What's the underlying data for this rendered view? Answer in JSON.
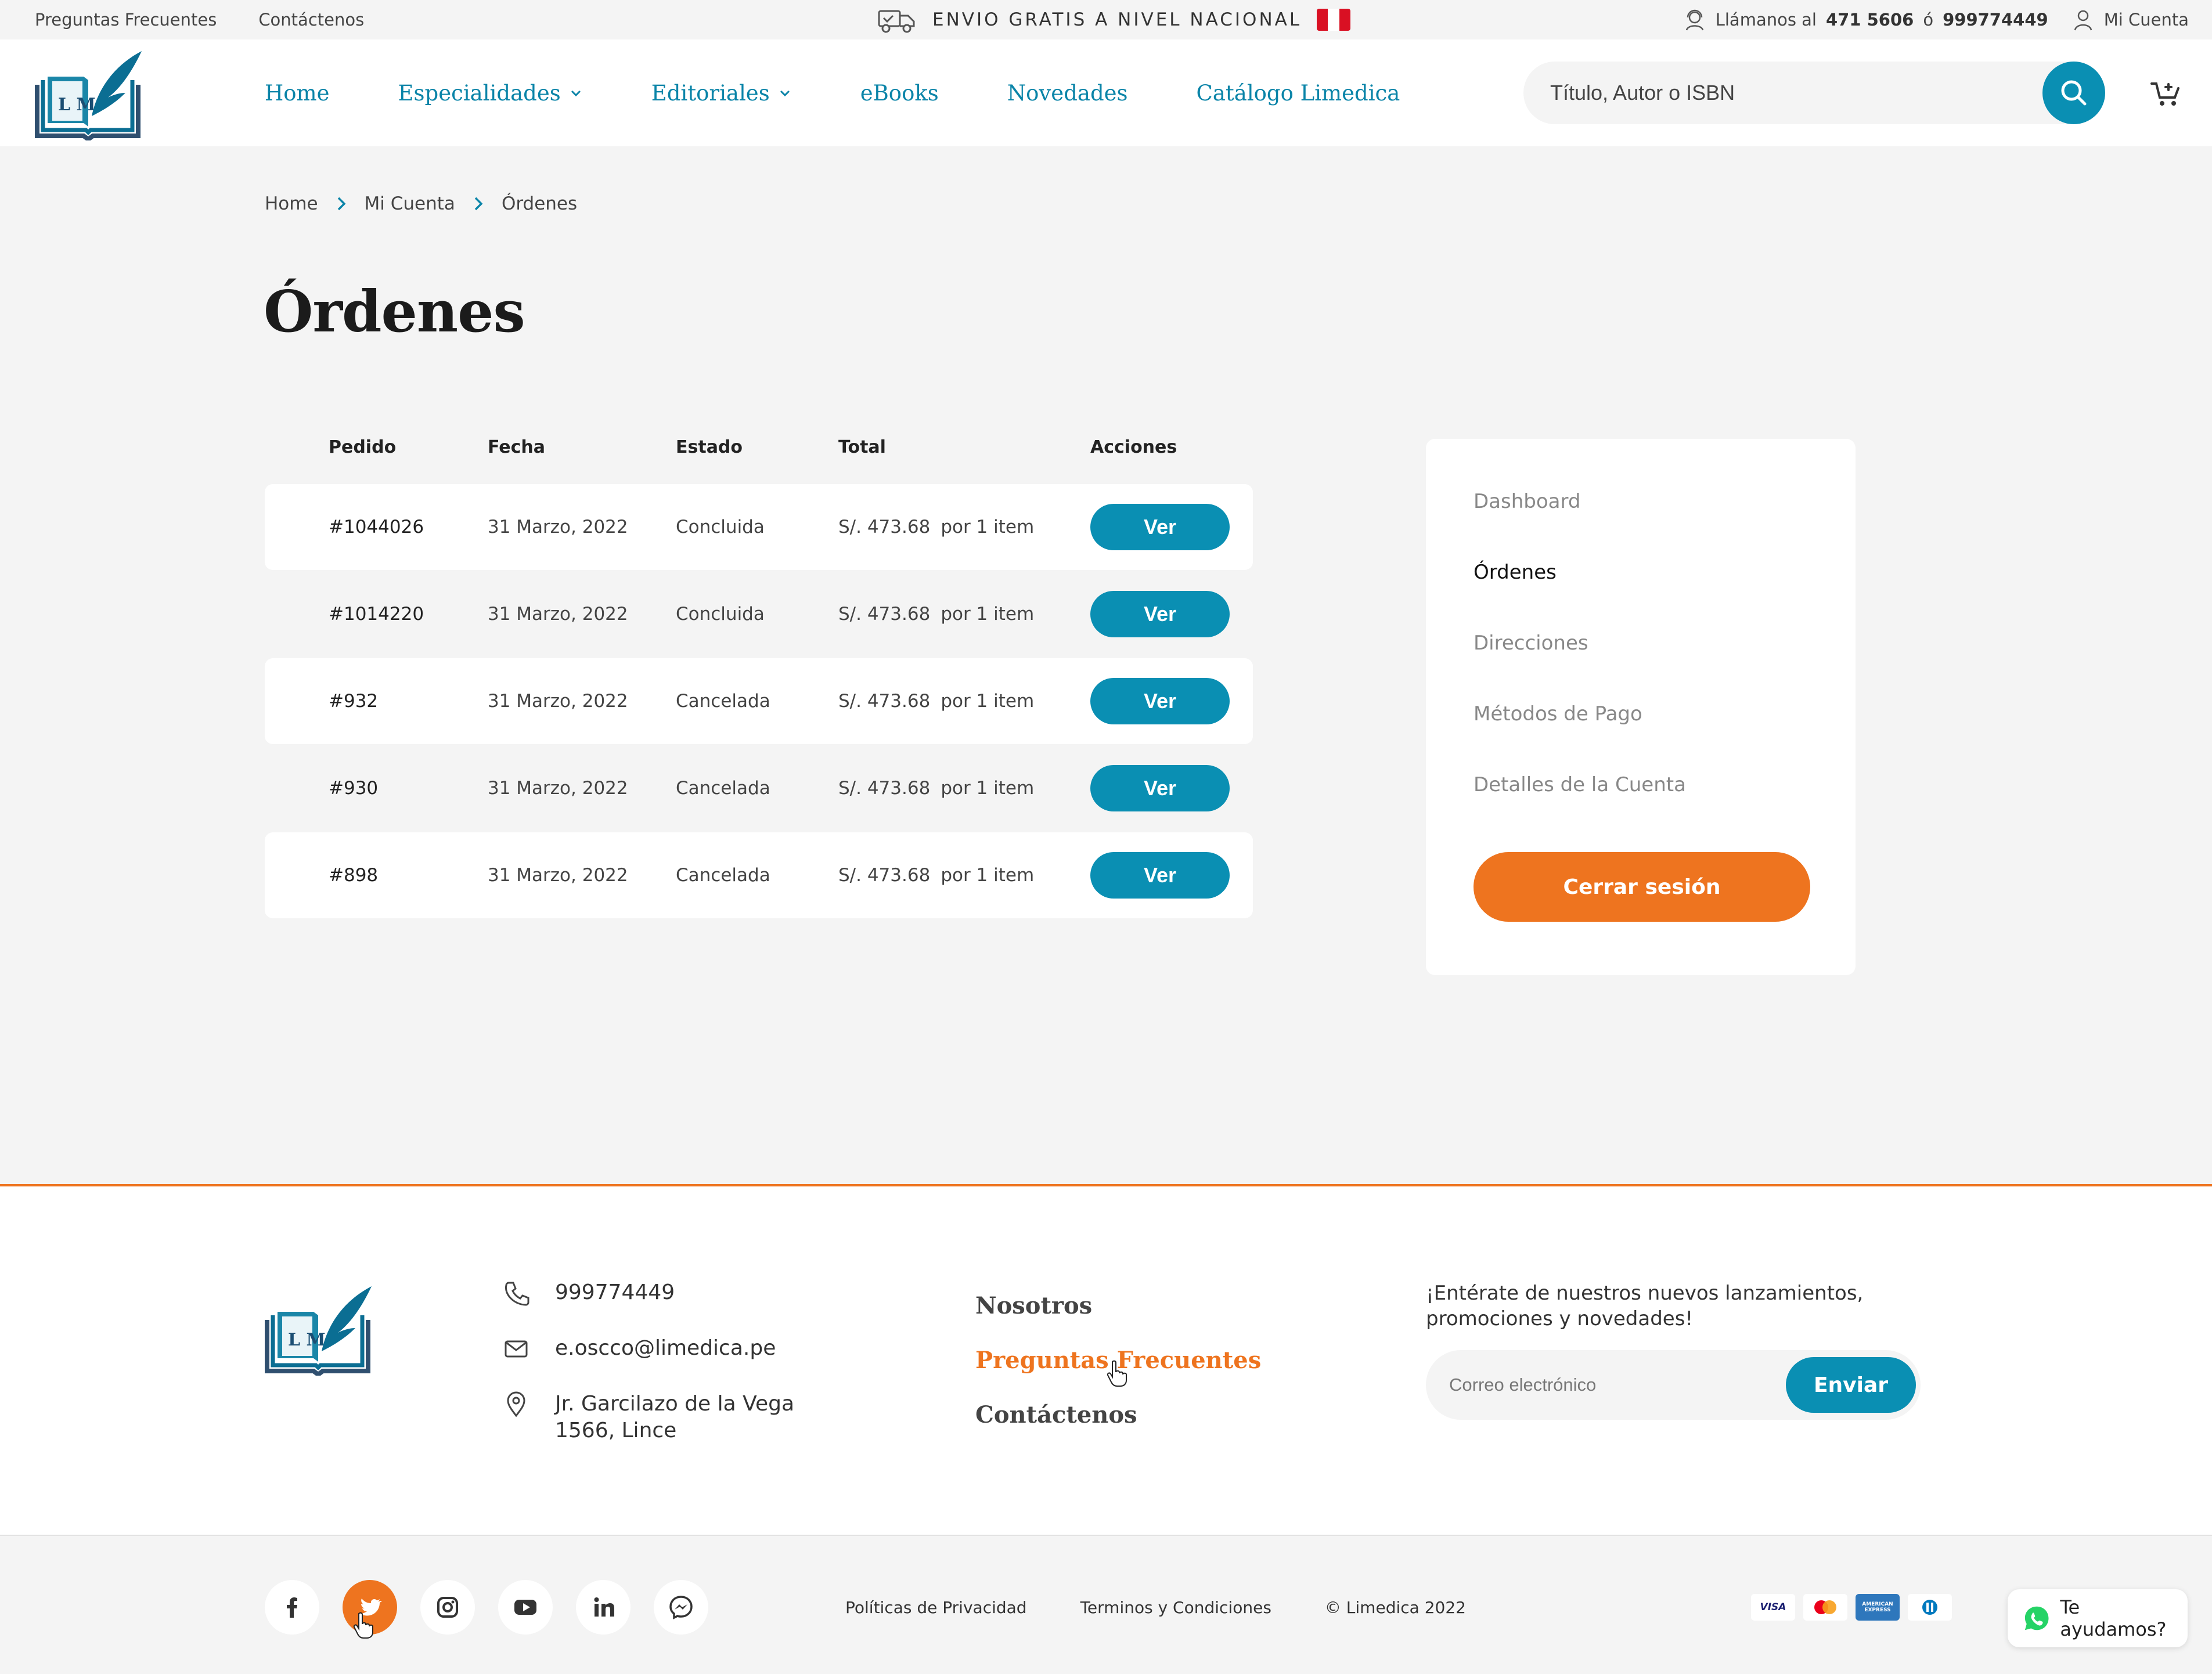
{
  "topbar": {
    "faq": "Preguntas Frecuentes",
    "contact": "Contáctenos",
    "promo": "ENVIO GRATIS A NIVEL NACIONAL",
    "call_label": "Llámanos al",
    "phone1": "471 5606",
    "or": "ó",
    "phone2": "999774449",
    "account": "Mi Cuenta"
  },
  "header": {
    "logo_text": "L M",
    "nav": [
      {
        "label": "Home"
      },
      {
        "label": "Especialidades"
      },
      {
        "label": "Editoriales"
      },
      {
        "label": "eBooks"
      },
      {
        "label": "Novedades"
      },
      {
        "label": "Catálogo Limedica"
      }
    ],
    "search_placeholder": "Título, Autor o ISBN"
  },
  "breadcrumb": [
    "Home",
    "Mi Cuenta",
    "Órdenes"
  ],
  "page_title": "Órdenes",
  "orders": {
    "columns": [
      "Pedido",
      "Fecha",
      "Estado",
      "Total",
      "Acciones"
    ],
    "action_label": "Ver",
    "rows": [
      {
        "id": "#1044026",
        "date": "31 Marzo, 2022",
        "status": "Concluida",
        "total": "S/. 473.68",
        "qty": "por 1 item"
      },
      {
        "id": "#1014220",
        "date": "31 Marzo, 2022",
        "status": "Concluida",
        "total": "S/. 473.68",
        "qty": "por 1 item"
      },
      {
        "id": "#932",
        "date": "31 Marzo, 2022",
        "status": "Cancelada",
        "total": "S/. 473.68",
        "qty": "por 1 item"
      },
      {
        "id": "#930",
        "date": "31 Marzo, 2022",
        "status": "Cancelada",
        "total": "S/. 473.68",
        "qty": "por 1 item"
      },
      {
        "id": "#898",
        "date": "31 Marzo, 2022",
        "status": "Cancelada",
        "total": "S/. 473.68",
        "qty": "por 1 item"
      }
    ]
  },
  "account_menu": {
    "items": [
      "Dashboard",
      "Órdenes",
      "Direcciones",
      "Métodos de Pago",
      "Detalles de la Cuenta"
    ],
    "active": "Órdenes",
    "logout": "Cerrar sesión"
  },
  "footer": {
    "phone": "999774449",
    "email": "e.oscco@limedica.pe",
    "address_line1": "Jr. Garcilazo de la Vega",
    "address_line2": "1566, Lince",
    "links": [
      "Nosotros",
      "Preguntas Frecuentes",
      "Contáctenos"
    ],
    "newsletter_text_line1": "¡Entérate de nuestros nuevos lanzamientos,",
    "newsletter_text_line2": "promociones y novedades!",
    "email_placeholder": "Correo electrónico",
    "send_label": "Enviar"
  },
  "bottom": {
    "socials": [
      "facebook-icon",
      "twitter-icon",
      "instagram-icon",
      "youtube-icon",
      "linkedin-icon",
      "messenger-icon"
    ],
    "privacy": "Políticas de Privacidad",
    "terms": "Terminos y Condiciones",
    "copyright": "© Limedica 2022",
    "payments": [
      "VISA",
      "mastercard",
      "AMERICAN EXPRESS",
      "Diners Club"
    ],
    "whatsapp": "Te ayudamos?"
  },
  "colors": {
    "primary": "#0a8fb3",
    "accent": "#ee741f",
    "background": "#f4f4f4"
  }
}
